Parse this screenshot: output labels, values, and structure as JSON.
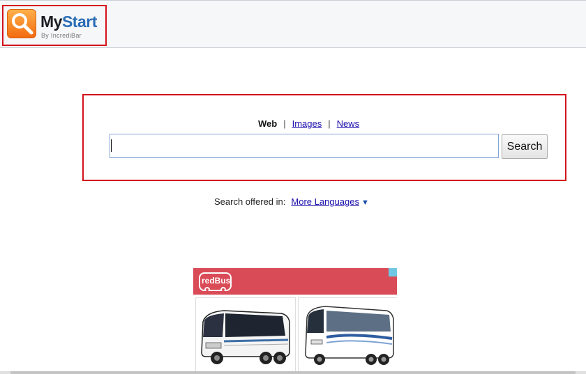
{
  "header": {
    "logo_my": "My",
    "logo_start": "Start",
    "logo_sub": "By IncrediBar"
  },
  "search": {
    "tabs": {
      "web": "Web",
      "separator": "|",
      "images": "Images",
      "news": "News"
    },
    "input_value": "",
    "button_label": "Search"
  },
  "language": {
    "prefix": "Search offered in:",
    "link": "More Languages",
    "arrow": "▼"
  },
  "ad": {
    "brand": "redBus",
    "brand_color": "#d94b57",
    "images": [
      "bus-image-1",
      "bus-image-2"
    ]
  },
  "colors": {
    "highlight": "#d4121b",
    "link": "#1a0dab",
    "logo_blue": "#2a6db5",
    "logo_orange": "#f26b10"
  }
}
